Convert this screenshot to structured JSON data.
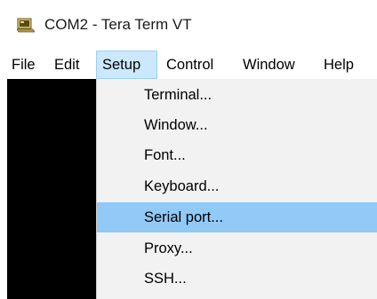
{
  "window": {
    "title": "COM2 - Tera Term VT",
    "icon": "tera-term-icon"
  },
  "menubar": {
    "items": [
      {
        "label": "File"
      },
      {
        "label": "Edit"
      },
      {
        "label": "Setup",
        "active": true
      },
      {
        "label": "Control"
      },
      {
        "label": "Window"
      },
      {
        "label": "Help"
      }
    ]
  },
  "setup_menu": {
    "items": [
      {
        "label": "Terminal..."
      },
      {
        "label": "Window..."
      },
      {
        "label": "Font..."
      },
      {
        "label": "Keyboard..."
      },
      {
        "label": "Serial port...",
        "highlighted": true
      },
      {
        "label": "Proxy..."
      },
      {
        "label": "SSH..."
      }
    ]
  },
  "colors": {
    "menu_active_bg": "#cce8ff",
    "menu_highlight_bg": "#91c9f7",
    "dropdown_bg": "#f2f2f2",
    "terminal_bg": "#000000"
  }
}
